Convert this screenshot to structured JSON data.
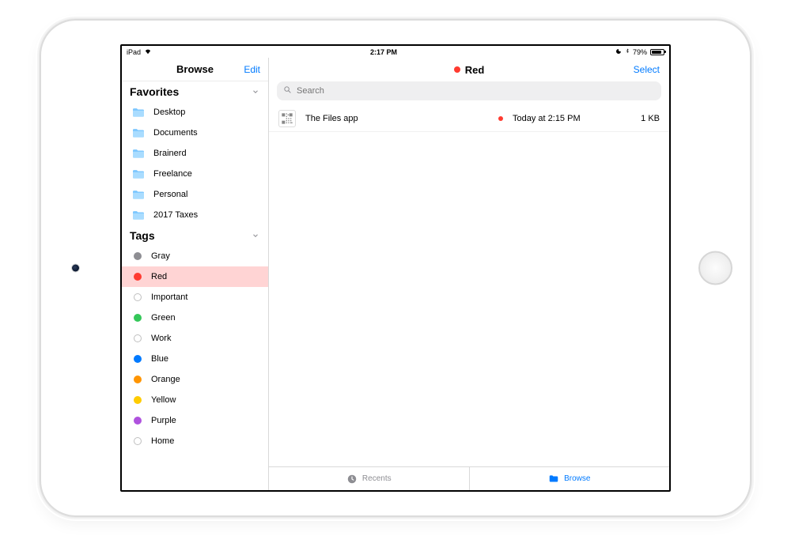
{
  "status_bar": {
    "carrier": "iPad",
    "time": "2:17 PM",
    "battery_pct": "79%"
  },
  "sidebar": {
    "title": "Browse",
    "edit_label": "Edit",
    "favorites_header": "Favorites",
    "tags_header": "Tags",
    "favorites": [
      {
        "label": "Desktop"
      },
      {
        "label": "Documents"
      },
      {
        "label": "Brainerd"
      },
      {
        "label": "Freelance"
      },
      {
        "label": "Personal"
      },
      {
        "label": "2017 Taxes"
      }
    ],
    "tags": [
      {
        "label": "Gray",
        "color": "#8e8e93"
      },
      {
        "label": "Red",
        "color": "#ff3b30",
        "selected": true
      },
      {
        "label": "Important",
        "hollow": true
      },
      {
        "label": "Green",
        "color": "#34c759"
      },
      {
        "label": "Work",
        "hollow": true
      },
      {
        "label": "Blue",
        "color": "#007aff"
      },
      {
        "label": "Orange",
        "color": "#ff9500"
      },
      {
        "label": "Yellow",
        "color": "#ffcc00"
      },
      {
        "label": "Purple",
        "color": "#af52de"
      },
      {
        "label": "Home",
        "hollow": true
      }
    ]
  },
  "main": {
    "title": "Red",
    "title_color": "#ff3b30",
    "select_label": "Select",
    "search_placeholder": "Search",
    "files": [
      {
        "name": "The Files app",
        "tag_color": "#ff3b30",
        "date": "Today at 2:15 PM",
        "size": "1 KB"
      }
    ]
  },
  "toolbar": {
    "recents_label": "Recents",
    "browse_label": "Browse"
  }
}
